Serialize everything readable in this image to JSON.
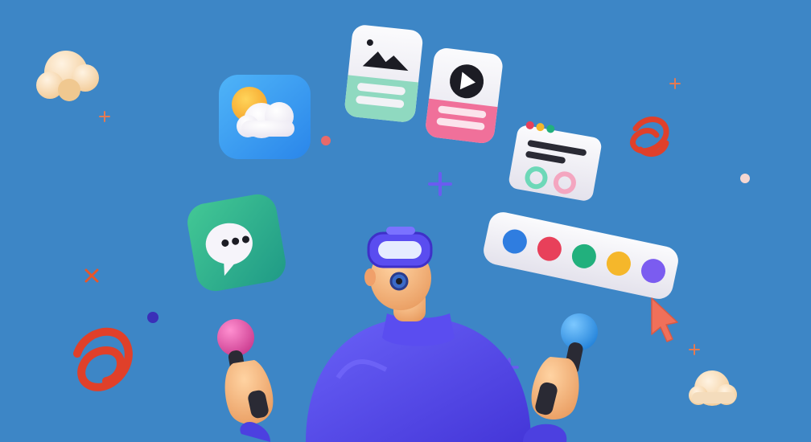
{
  "scene": {
    "background": "#3d86c6",
    "icons": [
      "weather-app-icon",
      "image-gallery-card-icon",
      "video-player-card-icon",
      "settings-panel-card-icon",
      "chat-bubble-app-icon",
      "color-palette-bar-icon",
      "mouse-cursor-icon",
      "vr-headset-icon"
    ],
    "palette_dots": [
      "#2f7de0",
      "#e8405a",
      "#22b07d",
      "#f5b72b",
      "#7b5cf0"
    ],
    "accent_colors": {
      "character_body": "#5a4df0",
      "skin": "#f2b27a",
      "swirl": "#e0402a",
      "cursor": "#f0705a",
      "controller_left_ball": "#e860b0",
      "controller_right_ball": "#3aa0ee"
    }
  }
}
